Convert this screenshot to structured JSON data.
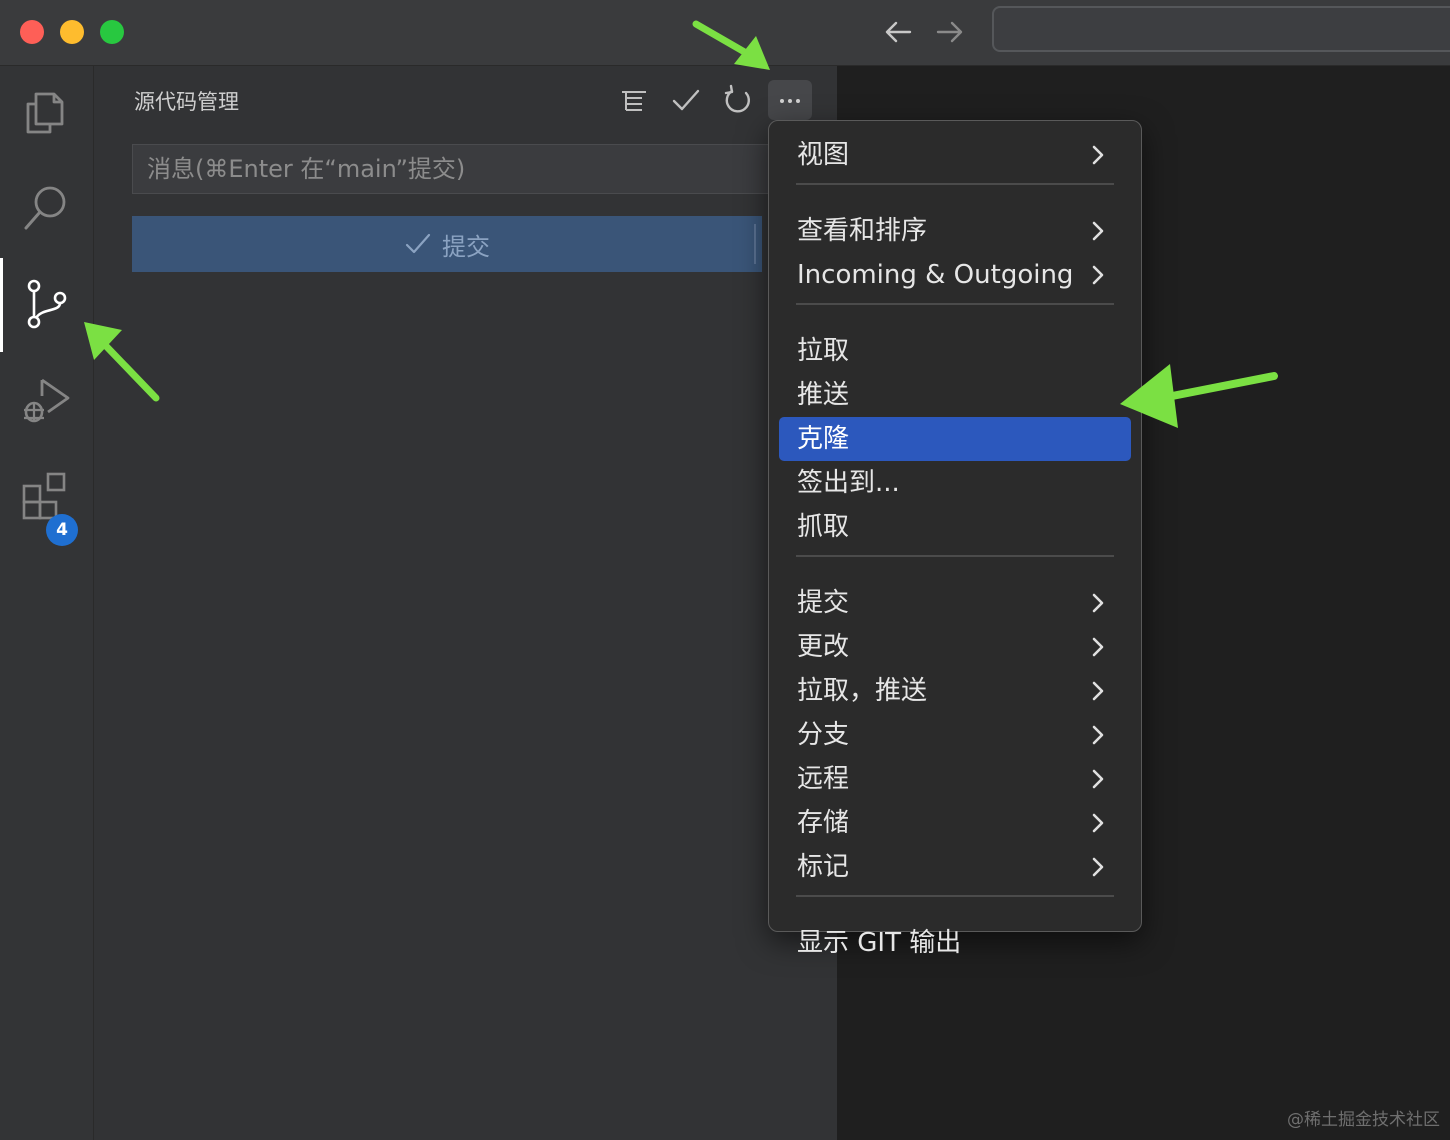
{
  "window": {
    "traffic_lights": {
      "close": "#fe5f57",
      "minimize": "#febc2e",
      "zoom": "#28c840"
    },
    "nav": {
      "back_icon": "arrow-left-icon",
      "forward_icon": "arrow-right-icon"
    }
  },
  "activity_bar": {
    "items": [
      {
        "name": "explorer",
        "icon": "files-icon",
        "active": false
      },
      {
        "name": "search",
        "icon": "search-icon",
        "active": false
      },
      {
        "name": "source-control",
        "icon": "source-control-icon",
        "active": true
      },
      {
        "name": "run-and-debug",
        "icon": "run-debug-icon",
        "active": false
      },
      {
        "name": "extensions",
        "icon": "extensions-icon",
        "active": false,
        "badge": "4"
      }
    ]
  },
  "sidebar": {
    "title": "源代码管理",
    "actions": [
      "view-as-tree-icon",
      "commit-check-icon",
      "refresh-icon",
      "more-actions-icon"
    ],
    "commit_input_placeholder": "消息(⌘Enter 在“main”提交)",
    "commit_button_label": "提交"
  },
  "menu": {
    "groups": [
      [
        {
          "label": "视图",
          "submenu": true
        }
      ],
      [
        {
          "label": "查看和排序",
          "submenu": true
        },
        {
          "label": "Incoming & Outgoing",
          "submenu": true
        }
      ],
      [
        {
          "label": "拉取",
          "submenu": false
        },
        {
          "label": "推送",
          "submenu": false
        },
        {
          "label": "克隆",
          "submenu": false,
          "highlighted": true
        },
        {
          "label": "签出到...",
          "submenu": false
        },
        {
          "label": "抓取",
          "submenu": false
        }
      ],
      [
        {
          "label": "提交",
          "submenu": true
        },
        {
          "label": "更改",
          "submenu": true
        },
        {
          "label": "拉取，推送",
          "submenu": true
        },
        {
          "label": "分支",
          "submenu": true
        },
        {
          "label": "远程",
          "submenu": true
        },
        {
          "label": "存储",
          "submenu": true
        },
        {
          "label": "标记",
          "submenu": true
        }
      ],
      [
        {
          "label": "显示 GIT 输出",
          "submenu": false
        }
      ]
    ],
    "highlight_color": "#2c58bd"
  },
  "annotations": {
    "arrow_color": "#7be043"
  },
  "watermark": "@稀土掘金技术社区"
}
